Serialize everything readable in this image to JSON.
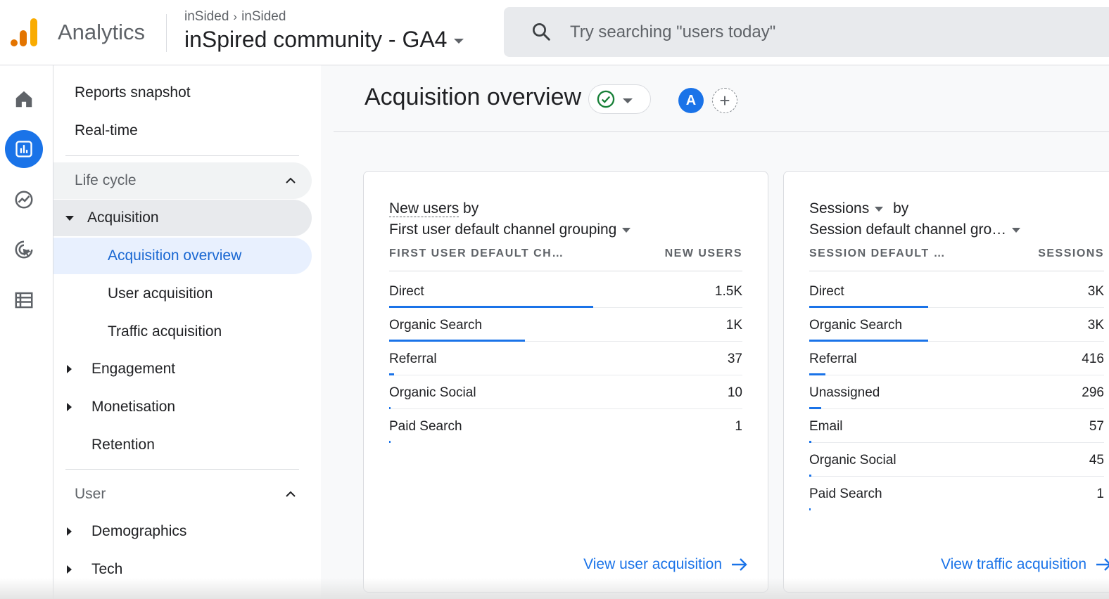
{
  "header": {
    "app_name": "Analytics",
    "breadcrumb": [
      "inSided",
      "inSided"
    ],
    "property_name": "inSpired community - GA4",
    "search_placeholder": "Try searching \"users today\""
  },
  "rail": {
    "items": [
      {
        "icon": "home-icon"
      },
      {
        "icon": "reports-icon",
        "active": true
      },
      {
        "icon": "explore-icon"
      },
      {
        "icon": "advertising-icon"
      },
      {
        "icon": "configure-icon"
      }
    ]
  },
  "sidenav": {
    "top_items": [
      "Reports snapshot",
      "Real-time"
    ],
    "lifecycle": {
      "label": "Life cycle",
      "acquisition": "Acquisition",
      "acquisition_children": [
        "Acquisition overview",
        "User acquisition",
        "Traffic acquisition"
      ],
      "engagement": "Engagement",
      "monetisation": "Monetisation",
      "retention": "Retention"
    },
    "user": {
      "label": "User",
      "demographics": "Demographics",
      "tech": "Tech"
    }
  },
  "page": {
    "title": "Acquisition overview",
    "avatar_letter": "A",
    "add_symbol": "+"
  },
  "card_new_users": {
    "title_line1_a": "New users",
    "title_line1_b": "by",
    "title_line2": "First user default channel grouping",
    "col_dimension": "FIRST USER DEFAULT CH…",
    "col_metric": "NEW USERS",
    "rows": [
      {
        "channel": "Direct",
        "value": "1.5K"
      },
      {
        "channel": "Organic Search",
        "value": "1K"
      },
      {
        "channel": "Referral",
        "value": "37"
      },
      {
        "channel": "Organic Social",
        "value": "10"
      },
      {
        "channel": "Paid Search",
        "value": "1"
      }
    ],
    "link": "View user acquisition"
  },
  "card_sessions": {
    "title_line1_a": "Sessions",
    "title_line1_b": "by",
    "title_line2": "Session default channel gro…",
    "col_dimension": "SESSION DEFAULT …",
    "col_metric": "SESSIONS",
    "rows": [
      {
        "channel": "Direct",
        "value": "3K"
      },
      {
        "channel": "Organic Search",
        "value": "3K"
      },
      {
        "channel": "Referral",
        "value": "416"
      },
      {
        "channel": "Unassigned",
        "value": "296"
      },
      {
        "channel": "Email",
        "value": "57"
      },
      {
        "channel": "Organic Social",
        "value": "45"
      },
      {
        "channel": "Paid Search",
        "value": "1"
      }
    ],
    "link": "View traffic acquisition"
  },
  "chart_data": [
    {
      "type": "bar",
      "ylabel": "NEW USERS",
      "categories": [
        "Direct",
        "Organic Search",
        "Referral",
        "Organic Social",
        "Paid Search"
      ],
      "values": [
        1500,
        1000,
        37,
        10,
        1
      ]
    },
    {
      "type": "bar",
      "ylabel": "SESSIONS",
      "categories": [
        "Direct",
        "Organic Search",
        "Referral",
        "Unassigned",
        "Email",
        "Organic Social",
        "Paid Search"
      ],
      "values": [
        3000,
        3000,
        416,
        296,
        57,
        45,
        1
      ]
    }
  ],
  "colors": {
    "accent": "#1a73e8",
    "active_nav_bg": "#e8f0fe",
    "status_green": "#188038",
    "logo_orange": "#f9ab00",
    "logo_dark_orange": "#e37400"
  }
}
